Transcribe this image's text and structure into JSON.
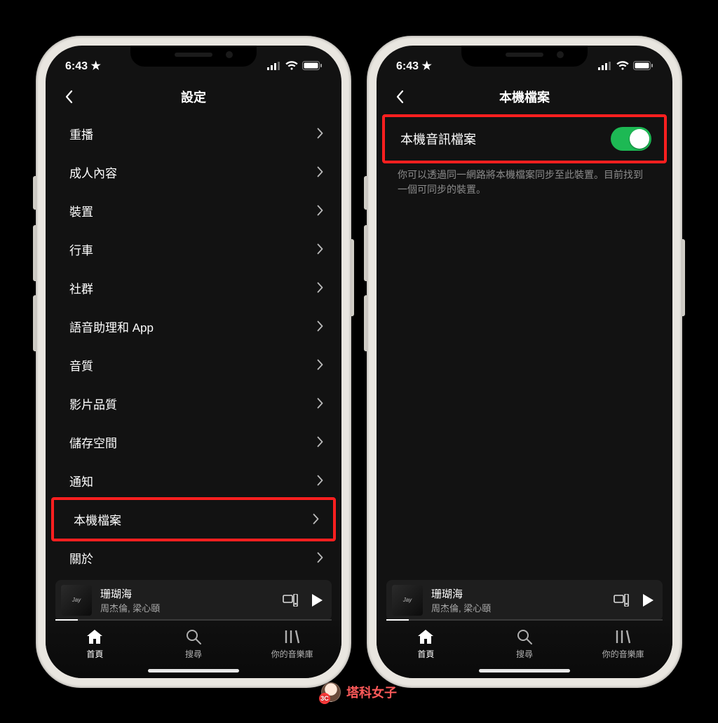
{
  "status": {
    "time": "6:43 ★"
  },
  "left": {
    "title": "設定",
    "items": [
      "重播",
      "成人內容",
      "裝置",
      "行車",
      "社群",
      "語音助理和 App",
      "音質",
      "影片品質",
      "儲存空間",
      "通知",
      "本機檔案",
      "關於"
    ],
    "highlight_index": 10
  },
  "right": {
    "title": "本機檔案",
    "toggle_label": "本機音訊檔案",
    "toggle_on": true,
    "description": "你可以透過同一網路將本機檔案同步至此裝置。目前找到一個可同步的裝置。"
  },
  "now_playing": {
    "title": "珊瑚海",
    "artist": "周杰倫, 梁心頤"
  },
  "tabs": {
    "home": "首頁",
    "search": "搜尋",
    "library": "你的音樂庫"
  },
  "watermark": "塔科女子"
}
